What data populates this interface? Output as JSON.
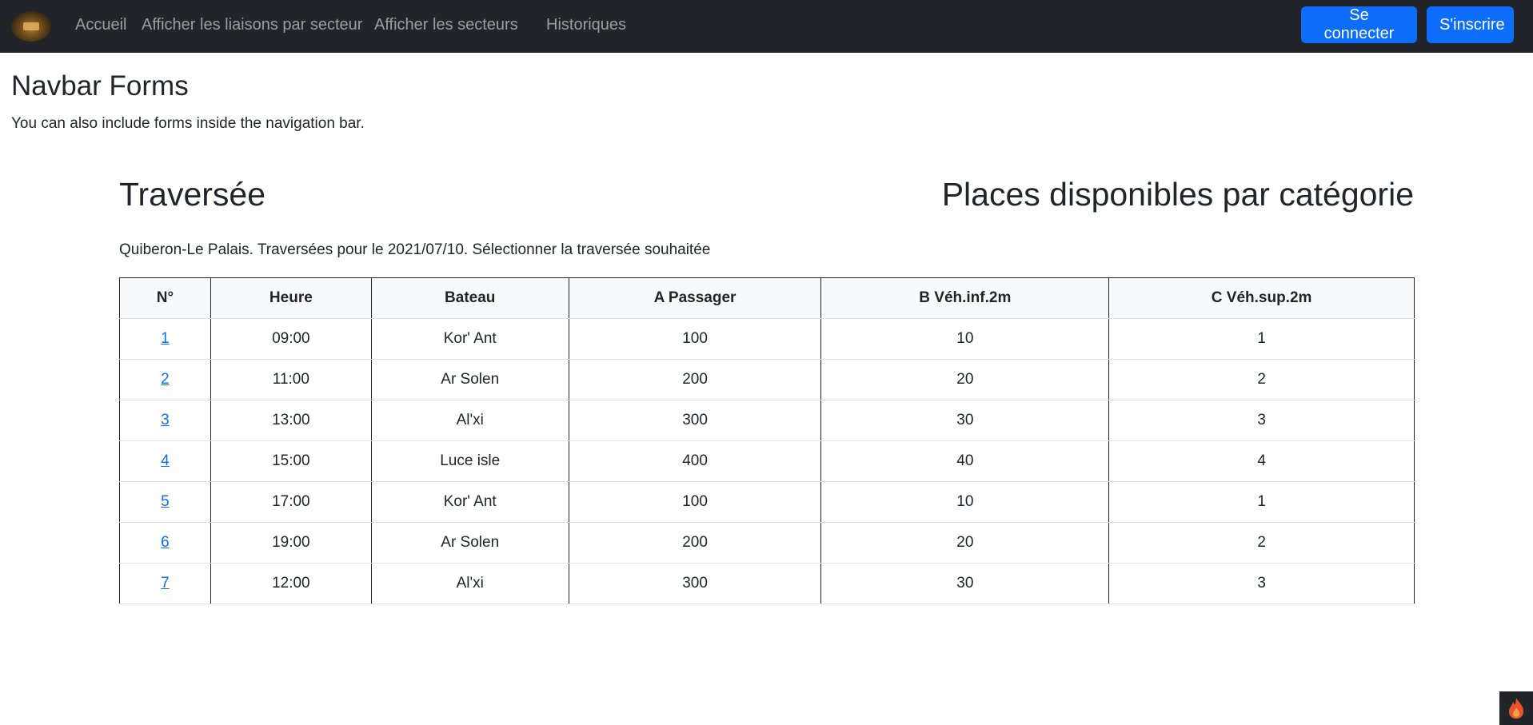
{
  "navbar": {
    "links": [
      "Accueil",
      "Afficher les liaisons par secteur",
      "Afficher les secteurs",
      "Historiques"
    ],
    "login_label": "Se connecter",
    "signup_label": "S'inscrire"
  },
  "page": {
    "title": "Navbar Forms",
    "subtitle": "You can also include forms inside the navigation bar."
  },
  "section": {
    "left_heading": "Traversée",
    "right_heading": "Places disponibles par catégorie",
    "description": "Quiberon-Le Palais. Traversées pour le 2021/07/10. Sélectionner la traversée souhaitée"
  },
  "table": {
    "headers": [
      "N°",
      "Heure",
      "Bateau",
      "A Passager",
      "B Véh.inf.2m",
      "C Véh.sup.2m"
    ],
    "rows": [
      [
        "1",
        "09:00",
        "Kor' Ant",
        "100",
        "10",
        "1"
      ],
      [
        "2",
        "11:00",
        "Ar Solen",
        "200",
        "20",
        "2"
      ],
      [
        "3",
        "13:00",
        "Al'xi",
        "300",
        "30",
        "3"
      ],
      [
        "4",
        "15:00",
        "Luce isle",
        "400",
        "40",
        "4"
      ],
      [
        "5",
        "17:00",
        "Kor' Ant",
        "100",
        "10",
        "1"
      ],
      [
        "6",
        "19:00",
        "Ar Solen",
        "200",
        "20",
        "2"
      ],
      [
        "7",
        "12:00",
        "Al'xi",
        "300",
        "30",
        "3"
      ]
    ]
  },
  "colors": {
    "navbar_bg": "#212529",
    "primary": "#0d6efd",
    "link": "#0d6efd",
    "badge_flame": "#e8552d"
  },
  "icons": {
    "logo": "ship-logo-icon",
    "corner": "flame-icon"
  }
}
